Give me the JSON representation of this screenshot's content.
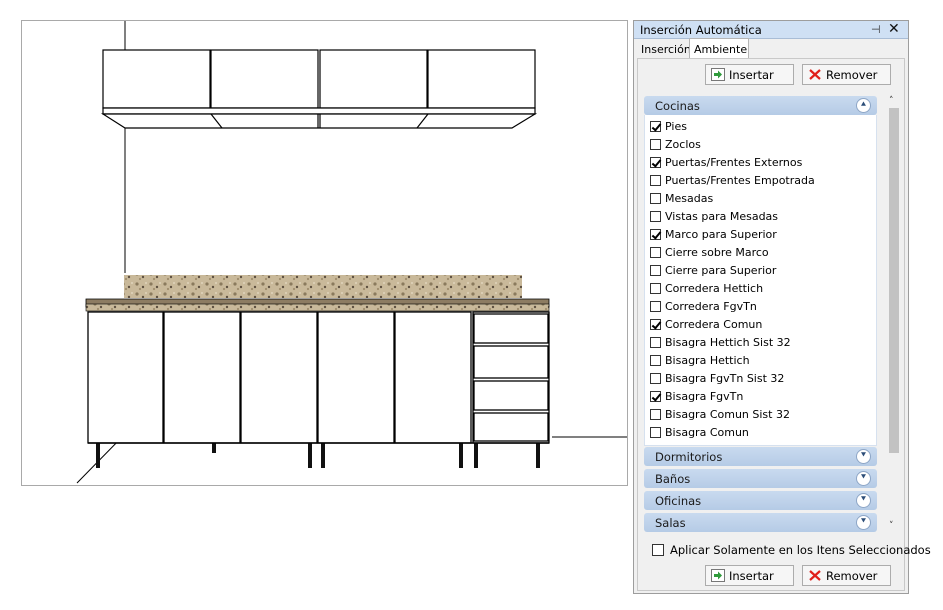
{
  "panel": {
    "title": "Inserción Automática",
    "pin_glyph": "⊣",
    "close_glyph": "✕",
    "tabs": [
      {
        "label": "Inserción",
        "active": false
      },
      {
        "label": "Ambiente",
        "active": true
      }
    ],
    "insert_label": "Insertar",
    "remove_label": "Remover",
    "categories": [
      {
        "label": "Cocinas",
        "expanded": true
      },
      {
        "label": "Dormitorios",
        "expanded": false
      },
      {
        "label": "Baños",
        "expanded": false
      },
      {
        "label": "Oficinas",
        "expanded": false
      },
      {
        "label": "Salas",
        "expanded": false
      }
    ],
    "cocinas_items": [
      {
        "label": "Pies",
        "checked": true
      },
      {
        "label": "Zoclos",
        "checked": false
      },
      {
        "label": "Puertas/Frentes Externos",
        "checked": true
      },
      {
        "label": "Puertas/Frentes Empotrada",
        "checked": false
      },
      {
        "label": "Mesadas",
        "checked": false
      },
      {
        "label": "Vistas para Mesadas",
        "checked": false
      },
      {
        "label": "Marco para Superior",
        "checked": true
      },
      {
        "label": "Cierre sobre Marco",
        "checked": false
      },
      {
        "label": "Cierre para Superior",
        "checked": false
      },
      {
        "label": "Corredera Hettich",
        "checked": false
      },
      {
        "label": "Corredera FgvTn",
        "checked": false
      },
      {
        "label": "Corredera Comun",
        "checked": true
      },
      {
        "label": "Bisagra Hettich Sist 32",
        "checked": false
      },
      {
        "label": "Bisagra Hettich",
        "checked": false
      },
      {
        "label": "Bisagra FgvTn Sist 32",
        "checked": false
      },
      {
        "label": "Bisagra FgvTn",
        "checked": true
      },
      {
        "label": "Bisagra Comun Sist 32",
        "checked": false
      },
      {
        "label": "Bisagra Comun",
        "checked": false
      }
    ],
    "apply_selected_label": "Aplicar Solamente en los Itens Seleccionados",
    "apply_selected_checked": false
  },
  "colors": {
    "title_bar": "#cfe0f4",
    "category_header": "#bfd3ec",
    "remove_x": "#e0201b",
    "insert_arrow": "#2e9a3a"
  },
  "icons": {
    "insert": "green-arrow-icon",
    "remove": "red-x-icon",
    "collapse": "double-chevron-up-icon",
    "expand": "double-chevron-down-icon"
  }
}
